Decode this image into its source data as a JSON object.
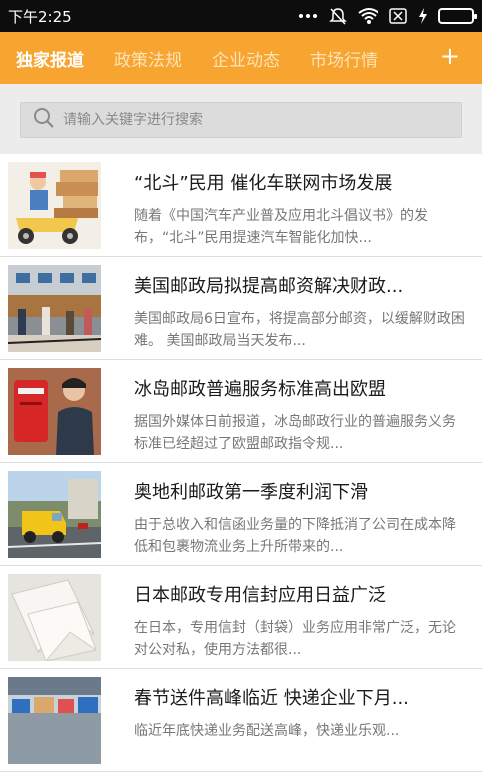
{
  "status_bar": {
    "time": "下午2:25",
    "icons": [
      "more-dots-icon",
      "mute-bell-icon",
      "wifi-icon",
      "sim-off-icon",
      "charging-icon",
      "battery-icon"
    ],
    "battery_color": "#3fd15a"
  },
  "tabs": [
    {
      "label": "独家报道",
      "active": true
    },
    {
      "label": "政策法规",
      "active": false
    },
    {
      "label": "企业动态",
      "active": false
    },
    {
      "label": "市场行情",
      "active": false
    }
  ],
  "tab_add_label": "+",
  "accent_color": "#f7a530",
  "search": {
    "placeholder": "请输入关键字进行搜索"
  },
  "news": [
    {
      "title": "“北斗”民用 催化车联网市场发展",
      "summary": "随着《中国汽车产业普及应用北斗倡议书》的发布，“北斗”民用提速汽车智能化加快...",
      "thumb": "courier-scooter"
    },
    {
      "title": "美国邮政局拟提高邮资解决财政...",
      "summary": "美国邮政局6日宣布，将提高部分邮资，以缓解财政困难。      美国邮政局当天发布...",
      "thumb": "post-office-hall"
    },
    {
      "title": "冰岛邮政普遍服务标准高出欧盟",
      "summary": "据国外媒体日前报道，冰岛邮政行业的普遍服务义务标准已经超过了欧盟邮政指令规...",
      "thumb": "red-mailbox-man"
    },
    {
      "title": "奥地利邮政第一季度利润下滑",
      "summary": "由于总收入和信函业务量的下降抵消了公司在成本降低和包裹物流业务上升所带来的...",
      "thumb": "yellow-van"
    },
    {
      "title": "日本邮政专用信封应用日益广泛",
      "summary": "在日本，专用信封（封袋）业务应用非常广泛，无论对公对私，使用方法都很...",
      "thumb": "envelopes"
    },
    {
      "title": "春节送件高峰临近 快递企业下月...",
      "summary": "临近年底快递业务配送高峰，快递业乐观...",
      "thumb": "parcels-warehouse"
    }
  ]
}
